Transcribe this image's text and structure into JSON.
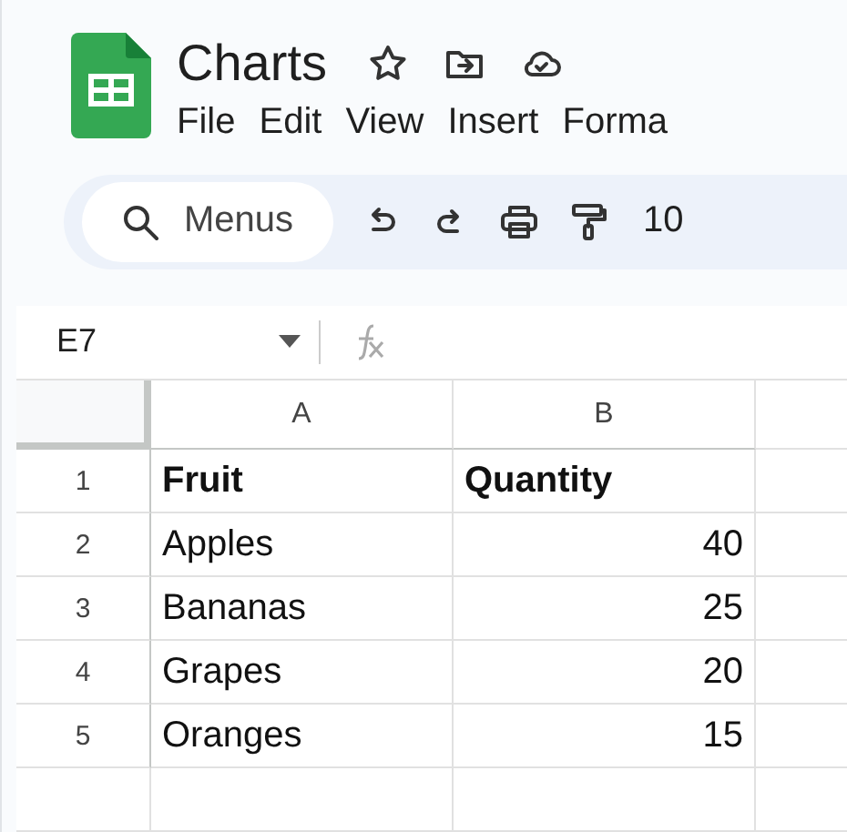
{
  "document": {
    "title": "Charts"
  },
  "menu": [
    "File",
    "Edit",
    "View",
    "Insert",
    "Forma"
  ],
  "toolbar": {
    "search": {
      "placeholder": "Menus"
    },
    "zoom": "10"
  },
  "formula_bar": {
    "cell_reference": "E7"
  },
  "sheet": {
    "columns": [
      "A",
      "B"
    ],
    "rows": [
      {
        "number": "1",
        "bold": true,
        "cells": [
          {
            "kind": "text",
            "value": "Fruit"
          },
          {
            "kind": "text",
            "value": "Quantity"
          }
        ]
      },
      {
        "number": "2",
        "bold": false,
        "cells": [
          {
            "kind": "text",
            "value": "Apples"
          },
          {
            "kind": "number",
            "value": "40"
          }
        ]
      },
      {
        "number": "3",
        "bold": false,
        "cells": [
          {
            "kind": "text",
            "value": "Bananas"
          },
          {
            "kind": "number",
            "value": "25"
          }
        ]
      },
      {
        "number": "4",
        "bold": false,
        "cells": [
          {
            "kind": "text",
            "value": "Grapes"
          },
          {
            "kind": "number",
            "value": "20"
          }
        ]
      },
      {
        "number": "5",
        "bold": false,
        "cells": [
          {
            "kind": "text",
            "value": "Oranges"
          },
          {
            "kind": "number",
            "value": "15"
          }
        ]
      }
    ]
  }
}
